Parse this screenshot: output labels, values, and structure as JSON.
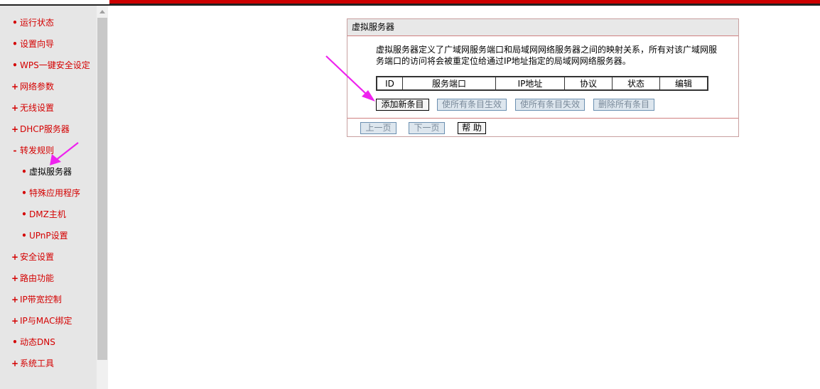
{
  "sidebar": {
    "items": [
      {
        "label": "运行状态",
        "marker": "•",
        "level": 1
      },
      {
        "label": "设置向导",
        "marker": "•",
        "level": 1
      },
      {
        "label": "WPS一键安全设定",
        "marker": "•",
        "level": 1
      },
      {
        "label": "网络参数",
        "marker": "+",
        "level": 1
      },
      {
        "label": "无线设置",
        "marker": "+",
        "level": 1
      },
      {
        "label": "DHCP服务器",
        "marker": "+",
        "level": 1
      },
      {
        "label": "转发规则",
        "marker": "-",
        "level": 1
      },
      {
        "label": "虚拟服务器",
        "marker": "•",
        "level": 2,
        "active": true
      },
      {
        "label": "特殊应用程序",
        "marker": "•",
        "level": 2
      },
      {
        "label": "DMZ主机",
        "marker": "•",
        "level": 2
      },
      {
        "label": "UPnP设置",
        "marker": "•",
        "level": 2
      },
      {
        "label": "安全设置",
        "marker": "+",
        "level": 1
      },
      {
        "label": "路由功能",
        "marker": "+",
        "level": 1
      },
      {
        "label": "IP带宽控制",
        "marker": "+",
        "level": 1
      },
      {
        "label": "IP与MAC绑定",
        "marker": "+",
        "level": 1
      },
      {
        "label": "动态DNS",
        "marker": "•",
        "level": 1
      },
      {
        "label": "系统工具",
        "marker": "+",
        "level": 1
      }
    ]
  },
  "panel": {
    "title": "虚拟服务器",
    "description": "虚拟服务器定义了广域网服务端口和局域网网络服务器之间的映射关系，所有对该广域网服务端口的访问将会被重定位给通过IP地址指定的局域网网络服务器。",
    "table": {
      "headers": [
        "ID",
        "服务端口",
        "IP地址",
        "协议",
        "状态",
        "编辑"
      ]
    },
    "buttons": {
      "add": "添加新条目",
      "enable_all": "使所有条目生效",
      "disable_all": "使所有条目失效",
      "delete_all": "删除所有条目"
    },
    "footer": {
      "prev": "上一页",
      "next": "下一页",
      "help": "帮 助"
    }
  },
  "colors": {
    "accent": "#cc0000",
    "nav_text": "#d40000",
    "annotation_arrow": "#ee22ee"
  }
}
